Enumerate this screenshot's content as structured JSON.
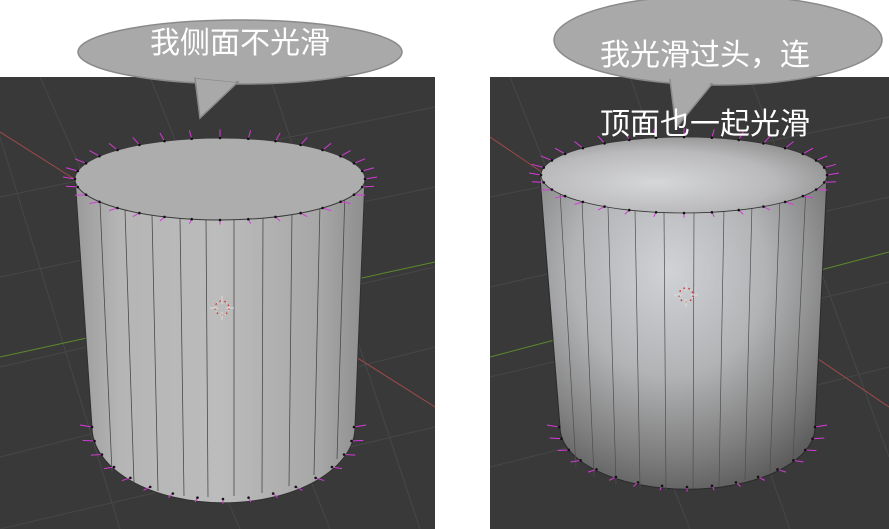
{
  "left_caption": "我侧面不光滑",
  "right_caption_line1": "我光滑过头，连",
  "right_caption_line2": "顶面也一起光滑",
  "colors": {
    "viewport_bg": "#393939",
    "grid_line": "#474747",
    "x_axis": "#a04a4a",
    "y_axis": "#5d8a2c",
    "normal_lines": "#d43bd8",
    "bubble_fill": "#a9a9a9",
    "bubble_stroke": "#8a8a8a",
    "caption_text": "#ffffff"
  },
  "icons": [
    "3d-cursor-icon",
    "vertex-normal-icon"
  ]
}
